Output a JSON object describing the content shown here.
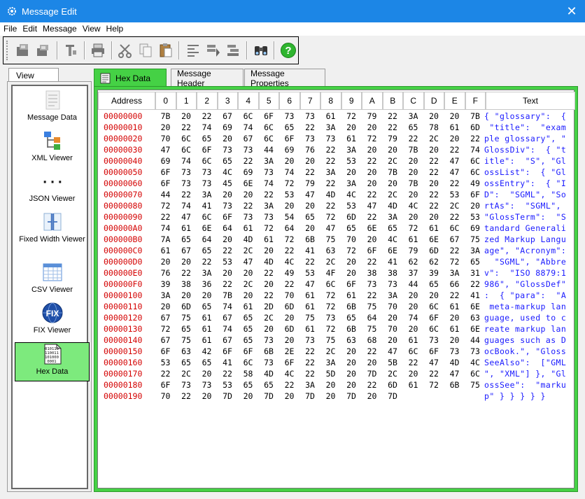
{
  "window": {
    "title": "Message Edit"
  },
  "menu": [
    "File",
    "Edit",
    "Message",
    "View",
    "Help"
  ],
  "view_panel": {
    "tab_label": "View",
    "items": [
      {
        "label": "Message Data",
        "icon": "document-icon"
      },
      {
        "label": "XML Viewer",
        "icon": "tree-icon"
      },
      {
        "label": "JSON Viewer",
        "icon": "braces-icon"
      },
      {
        "label": "Fixed Width Viewer",
        "icon": "fixed-width-icon"
      },
      {
        "label": "CSV Viewer",
        "icon": "grid-icon"
      },
      {
        "label": "FIX Viewer",
        "icon": "fix-globe-icon"
      },
      {
        "label": "Hex Data",
        "icon": "binary-icon",
        "selected": true
      }
    ]
  },
  "tabs": [
    {
      "label": "Hex Data",
      "active": true
    },
    {
      "label": "Message Header",
      "active": false
    },
    {
      "label": "Message Properties",
      "active": false
    }
  ],
  "hex": {
    "headers": [
      "Address",
      "0",
      "1",
      "2",
      "3",
      "4",
      "5",
      "6",
      "7",
      "8",
      "9",
      "A",
      "B",
      "C",
      "D",
      "E",
      "F",
      "Text"
    ],
    "rows": [
      {
        "addr": "00000000",
        "bytes": [
          "7B",
          "20",
          "22",
          "67",
          "6C",
          "6F",
          "73",
          "73",
          "61",
          "72",
          "79",
          "22",
          "3A",
          "20",
          "20",
          "7B"
        ],
        "text": "{ \"glossary\":  {"
      },
      {
        "addr": "00000010",
        "bytes": [
          "20",
          "22",
          "74",
          "69",
          "74",
          "6C",
          "65",
          "22",
          "3A",
          "20",
          "20",
          "22",
          "65",
          "78",
          "61",
          "6D"
        ],
        "text": " \"title\":  \"exam"
      },
      {
        "addr": "00000020",
        "bytes": [
          "70",
          "6C",
          "65",
          "20",
          "67",
          "6C",
          "6F",
          "73",
          "73",
          "61",
          "72",
          "79",
          "22",
          "2C",
          "20",
          "22"
        ],
        "text": "ple glossary\", \""
      },
      {
        "addr": "00000030",
        "bytes": [
          "47",
          "6C",
          "6F",
          "73",
          "73",
          "44",
          "69",
          "76",
          "22",
          "3A",
          "20",
          "20",
          "7B",
          "20",
          "22",
          "74"
        ],
        "text": "GlossDiv\":  { \"t"
      },
      {
        "addr": "00000040",
        "bytes": [
          "69",
          "74",
          "6C",
          "65",
          "22",
          "3A",
          "20",
          "20",
          "22",
          "53",
          "22",
          "2C",
          "20",
          "22",
          "47",
          "6C"
        ],
        "text": "itle\":  \"S\", \"Gl"
      },
      {
        "addr": "00000050",
        "bytes": [
          "6F",
          "73",
          "73",
          "4C",
          "69",
          "73",
          "74",
          "22",
          "3A",
          "20",
          "20",
          "7B",
          "20",
          "22",
          "47",
          "6C"
        ],
        "text": "ossList\":  { \"Gl"
      },
      {
        "addr": "00000060",
        "bytes": [
          "6F",
          "73",
          "73",
          "45",
          "6E",
          "74",
          "72",
          "79",
          "22",
          "3A",
          "20",
          "20",
          "7B",
          "20",
          "22",
          "49"
        ],
        "text": "ossEntry\":  { \"I"
      },
      {
        "addr": "00000070",
        "bytes": [
          "44",
          "22",
          "3A",
          "20",
          "20",
          "22",
          "53",
          "47",
          "4D",
          "4C",
          "22",
          "2C",
          "20",
          "22",
          "53",
          "6F"
        ],
        "text": "D\":  \"SGML\", \"So"
      },
      {
        "addr": "00000080",
        "bytes": [
          "72",
          "74",
          "41",
          "73",
          "22",
          "3A",
          "20",
          "20",
          "22",
          "53",
          "47",
          "4D",
          "4C",
          "22",
          "2C",
          "20"
        ],
        "text": "rtAs\":  \"SGML\", "
      },
      {
        "addr": "00000090",
        "bytes": [
          "22",
          "47",
          "6C",
          "6F",
          "73",
          "73",
          "54",
          "65",
          "72",
          "6D",
          "22",
          "3A",
          "20",
          "20",
          "22",
          "53"
        ],
        "text": "\"GlossTerm\":  \"S"
      },
      {
        "addr": "000000A0",
        "bytes": [
          "74",
          "61",
          "6E",
          "64",
          "61",
          "72",
          "64",
          "20",
          "47",
          "65",
          "6E",
          "65",
          "72",
          "61",
          "6C",
          "69"
        ],
        "text": "tandard Generali"
      },
      {
        "addr": "000000B0",
        "bytes": [
          "7A",
          "65",
          "64",
          "20",
          "4D",
          "61",
          "72",
          "6B",
          "75",
          "70",
          "20",
          "4C",
          "61",
          "6E",
          "67",
          "75"
        ],
        "text": "zed Markup Langu"
      },
      {
        "addr": "000000C0",
        "bytes": [
          "61",
          "67",
          "65",
          "22",
          "2C",
          "20",
          "22",
          "41",
          "63",
          "72",
          "6F",
          "6E",
          "79",
          "6D",
          "22",
          "3A"
        ],
        "text": "age\", \"Acronym\":"
      },
      {
        "addr": "000000D0",
        "bytes": [
          "20",
          "20",
          "22",
          "53",
          "47",
          "4D",
          "4C",
          "22",
          "2C",
          "20",
          "22",
          "41",
          "62",
          "62",
          "72",
          "65"
        ],
        "text": "  \"SGML\", \"Abbre"
      },
      {
        "addr": "000000E0",
        "bytes": [
          "76",
          "22",
          "3A",
          "20",
          "20",
          "22",
          "49",
          "53",
          "4F",
          "20",
          "38",
          "38",
          "37",
          "39",
          "3A",
          "31"
        ],
        "text": "v\":  \"ISO 8879:1"
      },
      {
        "addr": "000000F0",
        "bytes": [
          "39",
          "38",
          "36",
          "22",
          "2C",
          "20",
          "22",
          "47",
          "6C",
          "6F",
          "73",
          "73",
          "44",
          "65",
          "66",
          "22"
        ],
        "text": "986\", \"GlossDef\""
      },
      {
        "addr": "00000100",
        "bytes": [
          "3A",
          "20",
          "20",
          "7B",
          "20",
          "22",
          "70",
          "61",
          "72",
          "61",
          "22",
          "3A",
          "20",
          "20",
          "22",
          "41"
        ],
        "text": ":  { \"para\":  \"A"
      },
      {
        "addr": "00000110",
        "bytes": [
          "20",
          "6D",
          "65",
          "74",
          "61",
          "2D",
          "6D",
          "61",
          "72",
          "6B",
          "75",
          "70",
          "20",
          "6C",
          "61",
          "6E"
        ],
        "text": " meta-markup lan"
      },
      {
        "addr": "00000120",
        "bytes": [
          "67",
          "75",
          "61",
          "67",
          "65",
          "2C",
          "20",
          "75",
          "73",
          "65",
          "64",
          "20",
          "74",
          "6F",
          "20",
          "63"
        ],
        "text": "guage, used to c"
      },
      {
        "addr": "00000130",
        "bytes": [
          "72",
          "65",
          "61",
          "74",
          "65",
          "20",
          "6D",
          "61",
          "72",
          "6B",
          "75",
          "70",
          "20",
          "6C",
          "61",
          "6E"
        ],
        "text": "reate markup lan"
      },
      {
        "addr": "00000140",
        "bytes": [
          "67",
          "75",
          "61",
          "67",
          "65",
          "73",
          "20",
          "73",
          "75",
          "63",
          "68",
          "20",
          "61",
          "73",
          "20",
          "44"
        ],
        "text": "guages such as D"
      },
      {
        "addr": "00000150",
        "bytes": [
          "6F",
          "63",
          "42",
          "6F",
          "6F",
          "6B",
          "2E",
          "22",
          "2C",
          "20",
          "22",
          "47",
          "6C",
          "6F",
          "73",
          "73"
        ],
        "text": "ocBook.\", \"Gloss"
      },
      {
        "addr": "00000160",
        "bytes": [
          "53",
          "65",
          "65",
          "41",
          "6C",
          "73",
          "6F",
          "22",
          "3A",
          "20",
          "20",
          "5B",
          "22",
          "47",
          "4D",
          "4C"
        ],
        "text": "SeeAlso\":  [\"GML"
      },
      {
        "addr": "00000170",
        "bytes": [
          "22",
          "2C",
          "20",
          "22",
          "58",
          "4D",
          "4C",
          "22",
          "5D",
          "20",
          "7D",
          "2C",
          "20",
          "22",
          "47",
          "6C"
        ],
        "text": "\", \"XML\"] }, \"Gl"
      },
      {
        "addr": "00000180",
        "bytes": [
          "6F",
          "73",
          "73",
          "53",
          "65",
          "65",
          "22",
          "3A",
          "20",
          "20",
          "22",
          "6D",
          "61",
          "72",
          "6B",
          "75"
        ],
        "text": "ossSee\":  \"marku"
      },
      {
        "addr": "00000190",
        "bytes": [
          "70",
          "22",
          "20",
          "7D",
          "20",
          "7D",
          "20",
          "7D",
          "20",
          "7D",
          "20",
          "7D"
        ],
        "text": "p\" } } } } }"
      }
    ]
  }
}
